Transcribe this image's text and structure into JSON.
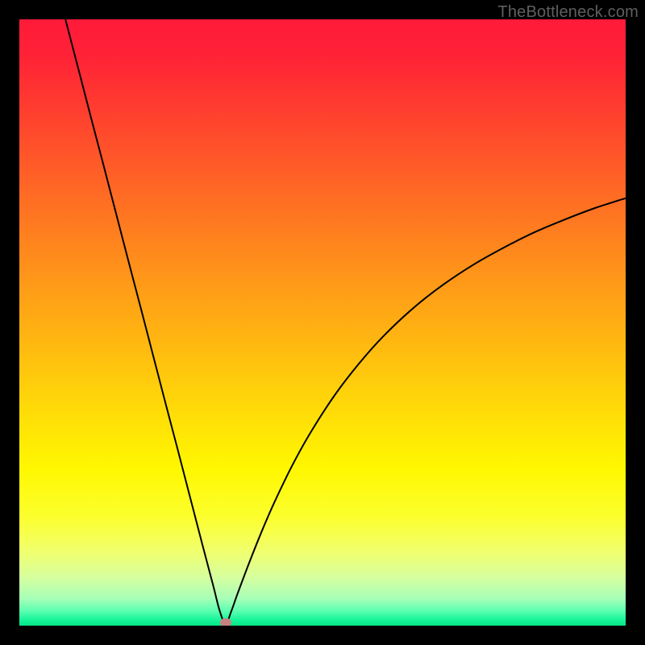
{
  "watermark": "TheBottleneck.com",
  "chart_data": {
    "type": "line",
    "title": "",
    "xlabel": "",
    "ylabel": "",
    "xlim": [
      0,
      100
    ],
    "ylim": [
      0,
      100
    ],
    "curve_minimum_x": 34,
    "marker": {
      "x": 34,
      "y": 0.5
    },
    "series": [
      {
        "name": "bottleneck-curve",
        "x": [
          7.6,
          10,
          12,
          14,
          16,
          18,
          20,
          22,
          24,
          26,
          28,
          30,
          32,
          33,
          34,
          35,
          36,
          38,
          40,
          42,
          45,
          48,
          52,
          56,
          60,
          65,
          70,
          75,
          80,
          85,
          90,
          95,
          100
        ],
        "values": [
          100,
          90.8,
          83.1,
          75.5,
          67.8,
          60.1,
          52.5,
          44.8,
          37.1,
          29.5,
          21.8,
          14.1,
          6.5,
          2.6,
          0.3,
          2.5,
          5.3,
          10.6,
          15.6,
          20.2,
          26.4,
          31.8,
          38.0,
          43.2,
          47.7,
          52.4,
          56.3,
          59.6,
          62.4,
          64.9,
          67.0,
          68.9,
          70.5
        ]
      }
    ],
    "gradient_stops": [
      {
        "offset": 0.0,
        "color": "#ff1a3a"
      },
      {
        "offset": 0.06,
        "color": "#ff2236"
      },
      {
        "offset": 0.15,
        "color": "#ff3e2f"
      },
      {
        "offset": 0.25,
        "color": "#ff5e27"
      },
      {
        "offset": 0.35,
        "color": "#ff7e1f"
      },
      {
        "offset": 0.45,
        "color": "#ff9e17"
      },
      {
        "offset": 0.55,
        "color": "#ffbd0f"
      },
      {
        "offset": 0.65,
        "color": "#ffdd08"
      },
      {
        "offset": 0.74,
        "color": "#fff700"
      },
      {
        "offset": 0.82,
        "color": "#fcff2d"
      },
      {
        "offset": 0.88,
        "color": "#f0ff70"
      },
      {
        "offset": 0.92,
        "color": "#d6ff9e"
      },
      {
        "offset": 0.955,
        "color": "#a8ffb8"
      },
      {
        "offset": 0.975,
        "color": "#5effb0"
      },
      {
        "offset": 0.99,
        "color": "#18f59a"
      },
      {
        "offset": 1.0,
        "color": "#06e586"
      }
    ]
  }
}
